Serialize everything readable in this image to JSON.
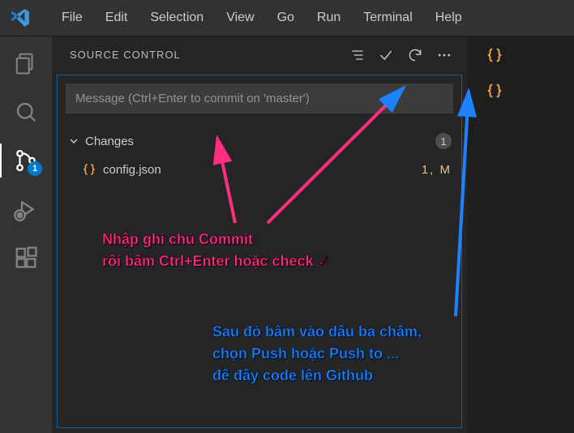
{
  "menubar": [
    "File",
    "Edit",
    "Selection",
    "View",
    "Go",
    "Run",
    "Terminal",
    "Help"
  ],
  "activity_badge": "1",
  "scm": {
    "title": "SOURCE CONTROL",
    "commit_placeholder": "Message (Ctrl+Enter to commit on 'master')",
    "changes_label": "Changes",
    "changes_count": "1",
    "files": [
      {
        "name": "config.json",
        "status": "1, M"
      }
    ]
  },
  "annotations": {
    "a1_line1": "Nhập ghi chú Commit",
    "a1_line2": "rồi bấm Ctrl+Enter hoặc check ✓",
    "a2_line1": "Sau đó bấm vào dấu ba chấm,",
    "a2_line2": "chọn Push hoặc Push to ...",
    "a2_line3": "để đẩy code lên Github"
  }
}
